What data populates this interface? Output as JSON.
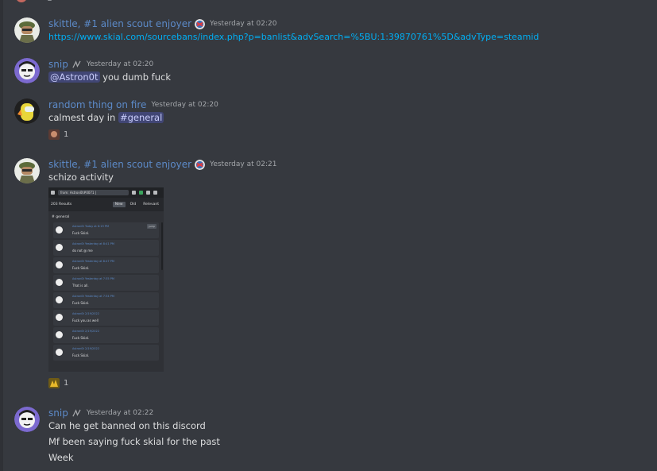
{
  "messages": [
    {
      "user": "skittle, #1 alien scout enjoyer",
      "time": "Yesterday at 02:20",
      "link": "https://www.skial.com/sourcebans/index.php?p=banlist&advSearch=%5BU:1:39870761%5D&advType=steamid"
    },
    {
      "user": "snip",
      "time": "Yesterday at 02:20",
      "mention": "@Astron0t",
      "text": " you dumb fuck"
    },
    {
      "user": "random thing on fire",
      "time": "Yesterday at 02:20",
      "text": "calmest day in ",
      "channel": "#general",
      "reaction_count": "1"
    },
    {
      "user": "skittle, #1 alien scout enjoyer",
      "time": "Yesterday at 02:21",
      "text": "schizo activity",
      "reaction_count": "1"
    },
    {
      "user": "snip",
      "time": "Yesterday at 02:22",
      "lines": [
        "Can he get banned on this discord",
        "Mf been saying fuck skial for the past",
        "Week"
      ]
    }
  ],
  "embedded_screenshot": {
    "search": "from: Astron0t#0071 |",
    "results": "203 Results",
    "tabs": [
      "New",
      "Old",
      "Relevant"
    ],
    "channel": "# general",
    "jump": "Jump",
    "cards": [
      {
        "name": "Astron0t  Today at 6:19 PM",
        "text": "Fuck Skial."
      },
      {
        "name": "Astron0t  Yesterday at 8:41 PM",
        "text": "do not @ me"
      },
      {
        "name": "Astron0t  Yesterday at 8:47 PM",
        "text": "Fuck Skial."
      },
      {
        "name": "Astron0t  Yesterday at 7:35 PM",
        "text": "That is all."
      },
      {
        "name": "Astron0t  Yesterday at 7:34 PM",
        "text": "Fuck Skial."
      },
      {
        "name": "Astron0t  2/19/2022",
        "text": "Fuck you as well"
      },
      {
        "name": "Astron0t  2/19/2022",
        "text": "Fuck Skial."
      },
      {
        "name": "Astron0t  2/19/2022",
        "text": "Fuck Skial."
      }
    ]
  },
  "colors": {
    "background": "#36393f",
    "username": "#5c8ac8",
    "link": "#00aff4",
    "mention_bg": "#414675"
  }
}
